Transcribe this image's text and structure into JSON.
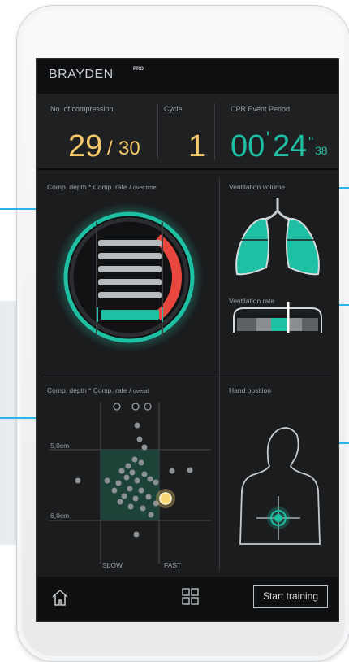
{
  "brand": {
    "name": "BRAYDEN",
    "tag": "PRO"
  },
  "stats": {
    "compression_label": "No. of compression",
    "compression_count": "29",
    "compression_sep": "/",
    "compression_total": "30",
    "cycle_label": "Cycle",
    "cycle_value": "1",
    "period_label": "CPR Event Period",
    "minutes": "00",
    "min_mark": "'",
    "seconds": "24",
    "sec_mark": "\"",
    "hundredths": "38"
  },
  "panels": {
    "depth_rate_time_label": "Comp. depth * Comp. rate /",
    "depth_rate_time_sub": "over time",
    "ventilation_volume_label": "Ventilation volume",
    "ventilation_rate_label": "Ventilation rate",
    "depth_rate_overall_label": "Comp. depth * Comp. rate /",
    "depth_rate_overall_sub": "overall",
    "hand_position_label": "Hand position"
  },
  "scatter": {
    "y_top_label": "5,0cm",
    "y_bottom_label": "6,0cm",
    "x_left_label": "SLOW",
    "x_right_label": "FAST"
  },
  "bottom": {
    "start_label": "Start training"
  },
  "icons": {
    "home": "home-icon",
    "grid": "grid-icon"
  },
  "colors": {
    "accent": "#1fbfa3",
    "number": "#f5c96a",
    "alert": "#e8473f",
    "callout": "#29b5e8"
  }
}
